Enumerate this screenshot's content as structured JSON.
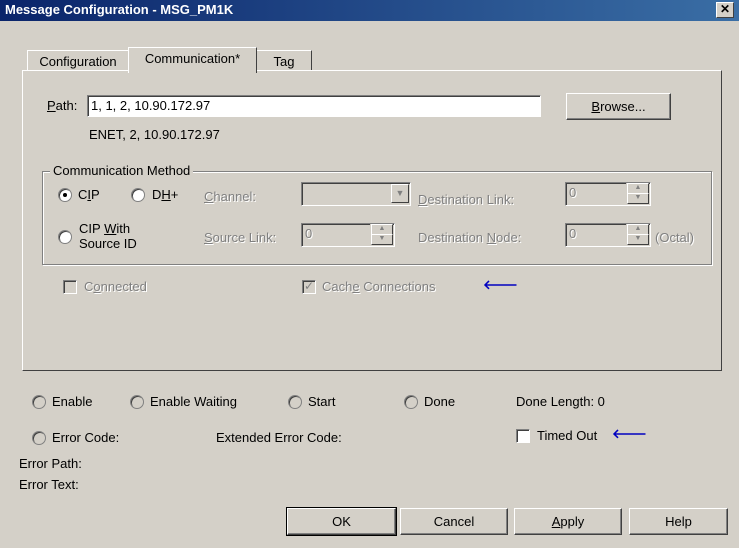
{
  "window": {
    "title": "Message Configuration - MSG_PM1K",
    "close": "✕"
  },
  "tabs": [
    {
      "label": "Configuration"
    },
    {
      "label": "Communication*"
    },
    {
      "label": "Tag"
    }
  ],
  "communication": {
    "path_label_u": "P",
    "path_label_rest": "ath:",
    "path_value": "1, 1, 2, 10.90.172.97",
    "path_resolved": "ENET, 2, 10.90.172.97",
    "browse_u": "B",
    "browse_rest": "rowse...",
    "method": {
      "group_label": "Communication Method",
      "cip_pre": "C",
      "cip_u": "I",
      "cip_post": "P",
      "dh_pre": "D",
      "dh_u": "H",
      "dh_post": "+",
      "channel_u": "C",
      "channel_rest": "hannel:",
      "dest_link_u": "D",
      "dest_link_rest": "estination Link:",
      "dest_link_value": "0",
      "cip_source_line1_pre": "CIP ",
      "cip_source_line1_u": "W",
      "cip_source_line1_post": "ith",
      "cip_source_line2": "Source ID",
      "source_link_u": "S",
      "source_link_rest": "ource Link:",
      "source_link_value": "0",
      "dest_node_pre": "Destination ",
      "dest_node_u": "N",
      "dest_node_rest": "ode:",
      "dest_node_value": "0",
      "octal": "(Octal)"
    },
    "connected_pre": "C",
    "connected_u": "o",
    "connected_rest": "nnected",
    "cache_pre": "Cach",
    "cache_u": "e",
    "cache_rest": " Connections",
    "arrow": "🡐"
  },
  "status": {
    "enable": "Enable",
    "enable_waiting": "Enable Waiting",
    "start": "Start",
    "done": "Done",
    "done_length": "Done Length: 0",
    "error_code": "Error Code:",
    "extended_error_code": "Extended Error Code:",
    "timed_out": "Timed Out",
    "arrow": "🡐",
    "error_path": "Error Path:",
    "error_text": "Error Text:"
  },
  "buttons": {
    "ok": "OK",
    "cancel": "Cancel",
    "apply_u": "A",
    "apply_rest": "pply",
    "help": "Help"
  }
}
